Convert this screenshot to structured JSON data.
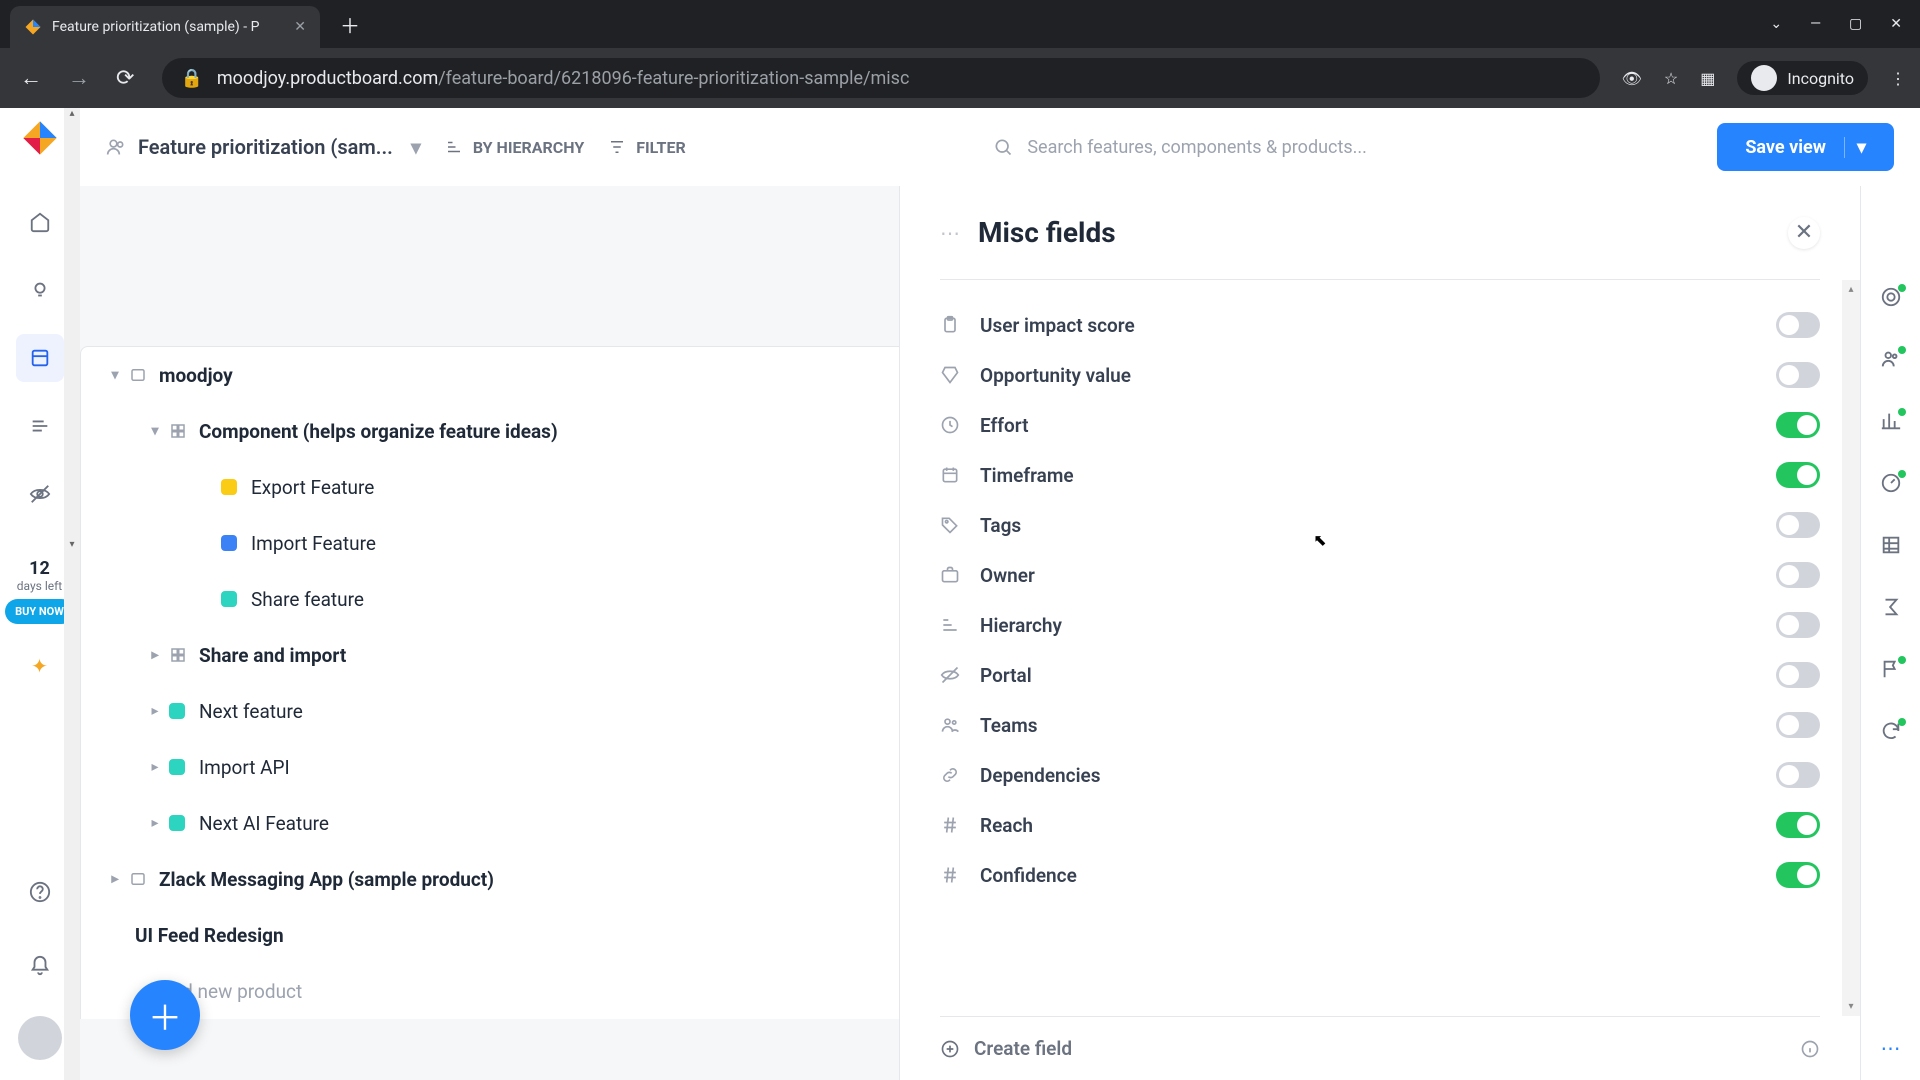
{
  "browser": {
    "tab_title": "Feature prioritization (sample) - P",
    "url_host": "moodjoy.productboard.com",
    "url_path": "/feature-board/6218096-feature-prioritization-sample/misc",
    "incognito_label": "Incognito"
  },
  "toolbar": {
    "board_title": "Feature prioritization (sam...",
    "by_hierarchy": "BY HIERARCHY",
    "filter": "FILTER",
    "search_placeholder": "Search features, components & products...",
    "save_view": "Save view"
  },
  "trial": {
    "days": "12",
    "label": "days left",
    "buy": "BUY NOW"
  },
  "tree": {
    "root": "moodjoy",
    "component_group": "Component (helps organize feature ideas)",
    "features": [
      {
        "label": "Export Feature",
        "color": "dot-yellow"
      },
      {
        "label": "Import Feature",
        "color": "dot-blue"
      },
      {
        "label": "Share feature",
        "color": "dot-teal"
      }
    ],
    "share_import": "Share and import",
    "teal_items": [
      "Next feature",
      "Import API",
      "Next AI Feature"
    ],
    "zlack": "Zlack Messaging App (sample product)",
    "ui_feed": "UI Feed Redesign",
    "add_product": "Add new product"
  },
  "panel": {
    "title": "Misc fields",
    "fields": [
      {
        "label": "User impact score",
        "on": false,
        "icon": "clipboard"
      },
      {
        "label": "Opportunity value",
        "on": false,
        "icon": "diamond"
      },
      {
        "label": "Effort",
        "on": true,
        "icon": "clock"
      },
      {
        "label": "Timeframe",
        "on": true,
        "icon": "calendar"
      },
      {
        "label": "Tags",
        "on": false,
        "icon": "tag"
      },
      {
        "label": "Owner",
        "on": false,
        "icon": "briefcase"
      },
      {
        "label": "Hierarchy",
        "on": false,
        "icon": "hierarchy"
      },
      {
        "label": "Portal",
        "on": false,
        "icon": "portal"
      },
      {
        "label": "Teams",
        "on": false,
        "icon": "teams"
      },
      {
        "label": "Dependencies",
        "on": false,
        "icon": "link"
      },
      {
        "label": "Reach",
        "on": true,
        "icon": "hash"
      },
      {
        "label": "Confidence",
        "on": true,
        "icon": "hash"
      }
    ],
    "create_field": "Create field"
  }
}
